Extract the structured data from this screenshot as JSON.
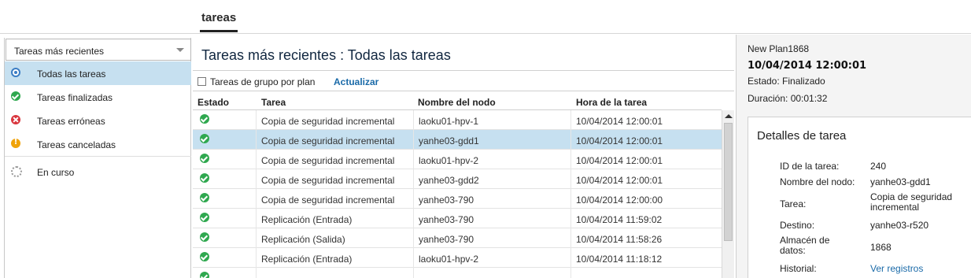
{
  "top_tab": {
    "label": "tareas"
  },
  "sidebar": {
    "filter": {
      "selected": "Tareas más recientes"
    },
    "items": [
      {
        "label": "Todas las tareas",
        "icon": "all-tasks-icon"
      },
      {
        "label": "Tareas finalizadas",
        "icon": "check-icon"
      },
      {
        "label": "Tareas erróneas",
        "icon": "error-icon"
      },
      {
        "label": "Tareas canceladas",
        "icon": "warning-icon"
      },
      {
        "label": "En curso",
        "icon": "spinner-icon"
      }
    ]
  },
  "main": {
    "title": "Tareas más recientes : Todas las tareas",
    "group_by_plan_label": "Tareas de grupo por plan",
    "refresh_label": "Actualizar",
    "columns": [
      "Estado",
      "Tarea",
      "Nombre del nodo",
      "Hora de la tarea"
    ],
    "rows": [
      {
        "status": "ok",
        "task": "Copia de seguridad incremental",
        "node": "laoku01-hpv-1",
        "time": "10/04/2014 12:00:01"
      },
      {
        "status": "ok",
        "task": "Copia de seguridad incremental",
        "node": "yanhe03-gdd1",
        "time": "10/04/2014 12:00:01"
      },
      {
        "status": "ok",
        "task": "Copia de seguridad incremental",
        "node": "laoku01-hpv-2",
        "time": "10/04/2014 12:00:01"
      },
      {
        "status": "ok",
        "task": "Copia de seguridad incremental",
        "node": "yanhe03-gdd2",
        "time": "10/04/2014 12:00:01"
      },
      {
        "status": "ok",
        "task": "Copia de seguridad incremental",
        "node": "yanhe03-790",
        "time": "10/04/2014 12:00:00"
      },
      {
        "status": "ok",
        "task": "Replicación (Entrada)",
        "node": "yanhe03-790",
        "time": "10/04/2014 11:59:02"
      },
      {
        "status": "ok",
        "task": "Replicación (Salida)",
        "node": "yanhe03-790",
        "time": "10/04/2014 11:58:26"
      },
      {
        "status": "ok",
        "task": "Replicación (Entrada)",
        "node": "laoku01-hpv-2",
        "time": "10/04/2014 11:18:12"
      }
    ]
  },
  "details": {
    "plan_name": "New Plan1868",
    "date": "10/04/2014 12:00:01",
    "status": "Estado: Finalizado",
    "duration": "Duración: 00:01:32",
    "box_title": "Detalles de tarea",
    "fields": {
      "task_id_label": "ID de la tarea:",
      "task_id": "240",
      "node_label": "Nombre del nodo:",
      "node": "yanhe03-gdd1",
      "task_label": "Tarea:",
      "task_line1": "Copia de seguridad",
      "task_line2": "incremental",
      "dest_label": "Destino:",
      "dest": "yanhe03-r520",
      "store_label_1": "Almacén de",
      "store_label_2": "datos:",
      "store": "1868",
      "history_label": "Historial:",
      "history_link": "Ver registros"
    }
  },
  "colors": {
    "selection": "#c6e0f0",
    "link": "#1a6aa8",
    "success": "#2fa84f",
    "error": "#d9363e",
    "warning": "#f0a30a"
  }
}
